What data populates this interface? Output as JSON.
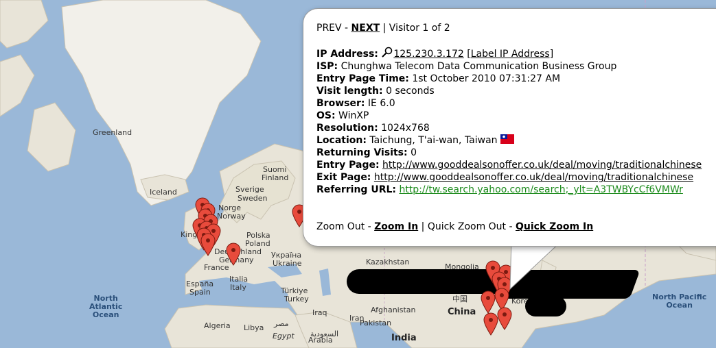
{
  "map": {
    "labels": {
      "greenland": "Greenland",
      "iceland": "Iceland",
      "suomi": "Suomi",
      "finland": "Finland",
      "sverige": "Sverige",
      "sweden": "Sweden",
      "norge": "Norge",
      "norway": "Norway",
      "polska": "Polska",
      "poland": "Poland",
      "ukraina_cyr": "Україна",
      "ukraine": "Ukraine",
      "deutschland": "Deutschland",
      "germany": "Germany",
      "france": "France",
      "kingdom": "Kingdom",
      "espana": "España",
      "spain": "Spain",
      "italia": "Italia",
      "italy": "Italy",
      "turkiye": "Türkiye",
      "turkey": "Turkey",
      "kazakhstan": "Kazakhstan",
      "mongolia": "Mongolia",
      "china_zh": "中国",
      "china": "China",
      "korea": "Korea",
      "iraq": "Iraq",
      "iran": "Iran",
      "afghanistan": "Afghanistan",
      "pakistan": "Pakistan",
      "algeria": "Algeria",
      "libya": "Libya",
      "misr": "مصر",
      "egypt": "Egypt",
      "saudi_arabia_ar": "السعودية",
      "saudi_arabia": "Arabia",
      "india": "India",
      "north_atlantic_ocean": [
        "North",
        "Atlantic",
        "Ocean"
      ],
      "north_pacific_ocean": [
        "North Pacific",
        "Ocean"
      ]
    },
    "marker_count": 19
  },
  "popup": {
    "nav": {
      "prev": "PREV",
      "sep1": " - ",
      "next": "NEXT",
      "sep2": " | ",
      "visitor": "Visitor 1 of 2"
    },
    "fields": {
      "ip_label": "IP Address:",
      "ip_value": "125.230.3.172",
      "ip_link": "[Label IP Address]",
      "isp_label": "ISP:",
      "isp_value": "Chunghwa Telecom Data Communication Business Group",
      "entry_time_label": "Entry Page Time:",
      "entry_time_value": "1st October 2010 07:31:27 AM",
      "visit_length_label": "Visit length:",
      "visit_length_value": "0 seconds",
      "browser_label": "Browser:",
      "browser_value": "IE 6.0",
      "os_label": "OS:",
      "os_value": "WinXP",
      "resolution_label": "Resolution:",
      "resolution_value": "1024x768",
      "location_label": "Location:",
      "location_value": "Taichung, T'ai-wan, Taiwan",
      "returning_label": "Returning Visits:",
      "returning_value": "0",
      "entry_page_label": "Entry Page:",
      "entry_page_value": "http://www.gooddealsonoffer.co.uk/deal/moving/traditionalchinese",
      "exit_page_label": "Exit Page:",
      "exit_page_value": "http://www.gooddealsonoffer.co.uk/deal/moving/traditionalchinese",
      "referring_label": "Referring URL:",
      "referring_value": "http://tw.search.yahoo.com/search;_ylt=A3TWBYcCf6VMWr"
    },
    "zoom": {
      "zoom_out": "Zoom Out",
      "sep1": " - ",
      "zoom_in": "Zoom In",
      "sep2": " | ",
      "quick_zoom_out": "Quick Zoom Out",
      "sep3": " - ",
      "quick_zoom_in": "Quick Zoom In"
    }
  },
  "colors": {
    "water": "#9ab8d8",
    "land": "#e8e4d8",
    "marker": "#e84b3c",
    "link_green": "#1a8a1a"
  }
}
